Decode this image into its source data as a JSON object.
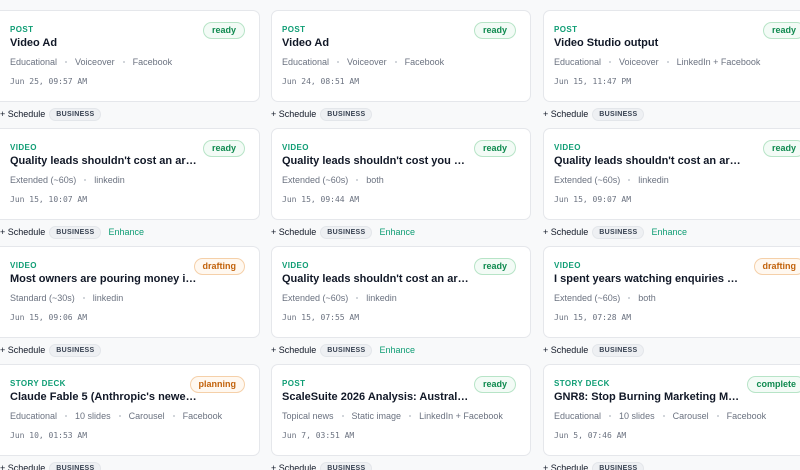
{
  "cards": [
    {
      "kind": "POST",
      "title": "Video Ad",
      "meta": [
        "Educational",
        "Voiceover",
        "Facebook"
      ],
      "date": "Jun 25, 09:57 AM",
      "status": "ready",
      "tag": "BUSINESS",
      "schedule": "+ Schedule",
      "enhance": ""
    },
    {
      "kind": "POST",
      "title": "Video Ad",
      "meta": [
        "Educational",
        "Voiceover",
        "Facebook"
      ],
      "date": "Jun 24, 08:51 AM",
      "status": "ready",
      "tag": "BUSINESS",
      "schedule": "+ Schedule",
      "enhance": ""
    },
    {
      "kind": "POST",
      "title": "Video Studio output",
      "meta": [
        "Educational",
        "Voiceover",
        "LinkedIn + Facebook"
      ],
      "date": "Jun 15, 11:47 PM",
      "status": "ready",
      "tag": "BUSINESS",
      "schedule": "+ Schedule",
      "enhance": ""
    },
    {
      "kind": "VIDEO",
      "title": "Quality leads shouldn't cost an arm and...",
      "meta": [
        "Extended (~60s)",
        "linkedin"
      ],
      "date": "Jun 15, 10:07 AM",
      "status": "ready",
      "tag": "BUSINESS",
      "schedule": "+ Schedule",
      "enhance": "Enhance"
    },
    {
      "kind": "VIDEO",
      "title": "Quality leads shouldn't cost you your e...",
      "meta": [
        "Extended (~60s)",
        "both"
      ],
      "date": "Jun 15, 09:44 AM",
      "status": "ready",
      "tag": "BUSINESS",
      "schedule": "+ Schedule",
      "enhance": "Enhance"
    },
    {
      "kind": "VIDEO",
      "title": "Quality leads shouldn't cost an arm and...",
      "meta": [
        "Extended (~60s)",
        "linkedin"
      ],
      "date": "Jun 15, 09:07 AM",
      "status": "ready",
      "tag": "BUSINESS",
      "schedule": "+ Schedule",
      "enhance": "Enhance"
    },
    {
      "kind": "VIDEO",
      "title": "Most owners are pouring money into l...",
      "meta": [
        "Standard (~30s)",
        "linkedin"
      ],
      "date": "Jun 15, 09:06 AM",
      "status": "drafting",
      "tag": "BUSINESS",
      "schedule": "+ Schedule",
      "enhance": ""
    },
    {
      "kind": "VIDEO",
      "title": "Quality leads shouldn't cost an arm and...",
      "meta": [
        "Extended (~60s)",
        "linkedin"
      ],
      "date": "Jun 15, 07:55 AM",
      "status": "ready",
      "tag": "BUSINESS",
      "schedule": "+ Schedule",
      "enhance": "Enhance"
    },
    {
      "kind": "VIDEO",
      "title": "I spent years watching enquiries go c...",
      "meta": [
        "Extended (~60s)",
        "both"
      ],
      "date": "Jun 15, 07:28 AM",
      "status": "drafting",
      "tag": "BUSINESS",
      "schedule": "+ Schedule",
      "enhance": ""
    },
    {
      "kind": "STORY DECK",
      "title": "Claude Fable 5 (Anthropic's newest r...",
      "meta": [
        "Educational",
        "10 slides",
        "Carousel",
        "Facebook"
      ],
      "date": "Jun 10, 01:53 AM",
      "status": "planning",
      "tag": "BUSINESS",
      "schedule": "+ Schedule",
      "enhance": ""
    },
    {
      "kind": "POST",
      "title": "ScaleSuite 2026 Analysis: Australian S...",
      "meta": [
        "Topical news",
        "Static image",
        "LinkedIn + Facebook"
      ],
      "date": "Jun 7, 03:51 AM",
      "status": "ready",
      "tag": "BUSINESS",
      "schedule": "+ Schedule",
      "enhance": ""
    },
    {
      "kind": "STORY DECK",
      "title": "GNR8: Stop Burning Marketing Mon...",
      "meta": [
        "Educational",
        "10 slides",
        "Carousel",
        "Facebook"
      ],
      "date": "Jun 5, 07:46 AM",
      "status": "complete",
      "tag": "BUSINESS",
      "schedule": "+ Schedule",
      "enhance": ""
    }
  ]
}
